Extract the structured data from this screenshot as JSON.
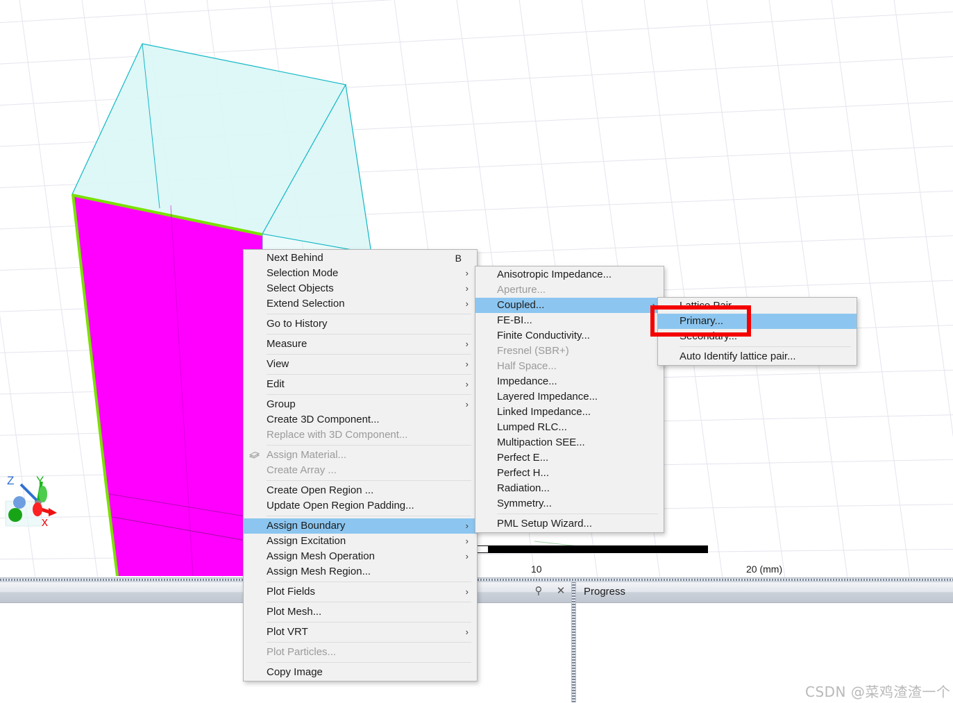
{
  "app": {
    "viewport_name": "3d-modeler-viewport",
    "background": "#ffffff",
    "grid_color": "#e3e3ec"
  },
  "geometry": {
    "top_face_color": "#ddf7f7",
    "top_face_edge_color": "#00b6c8",
    "selected_face_color": "#ff00ff",
    "selected_edge_color": "#7ae000",
    "description": "Rectangular box, top face shaded cyan, front-left face selected magenta"
  },
  "axis_triad": {
    "x_label": "x",
    "y_label": "Y",
    "z_label": "Z",
    "x_color": "#ee1111",
    "y_color": "#1bb81b",
    "z_color": "#2f6fd0"
  },
  "scale_bar": {
    "tick_mid": "10",
    "tick_end": "20 (mm)"
  },
  "bottom_panes": {
    "left_pane": {
      "title": "",
      "pin_icon": "pin-icon",
      "close_icon": "close-icon"
    },
    "right_pane": {
      "title": "Progress"
    }
  },
  "watermark": {
    "text": "CSDN @菜鸡渣渣一个"
  },
  "context_menu": {
    "name": "modeler-context-menu",
    "items": [
      {
        "label": "Next Behind",
        "accel": "B",
        "arrow": false,
        "disabled": false,
        "selected": false,
        "sep_after": false
      },
      {
        "label": "Selection Mode",
        "accel": "",
        "arrow": true,
        "disabled": false,
        "selected": false,
        "sep_after": false
      },
      {
        "label": "Select Objects",
        "accel": "",
        "arrow": true,
        "disabled": false,
        "selected": false,
        "sep_after": false
      },
      {
        "label": "Extend Selection",
        "accel": "",
        "arrow": true,
        "disabled": false,
        "selected": false,
        "sep_after": true
      },
      {
        "label": "Go to History",
        "accel": "",
        "arrow": false,
        "disabled": false,
        "selected": false,
        "sep_after": true
      },
      {
        "label": "Measure",
        "accel": "",
        "arrow": true,
        "disabled": false,
        "selected": false,
        "sep_after": true
      },
      {
        "label": "View",
        "accel": "",
        "arrow": true,
        "disabled": false,
        "selected": false,
        "sep_after": true
      },
      {
        "label": "Edit",
        "accel": "",
        "arrow": true,
        "disabled": false,
        "selected": false,
        "sep_after": true
      },
      {
        "label": "Group",
        "accel": "",
        "arrow": true,
        "disabled": false,
        "selected": false,
        "sep_after": false
      },
      {
        "label": "Create 3D Component...",
        "accel": "",
        "arrow": false,
        "disabled": false,
        "selected": false,
        "sep_after": false
      },
      {
        "label": "Replace with 3D Component...",
        "accel": "",
        "arrow": false,
        "disabled": true,
        "selected": false,
        "sep_after": true
      },
      {
        "label": "Assign Material...",
        "accel": "",
        "arrow": false,
        "disabled": true,
        "selected": false,
        "sep_after": false,
        "icon": "material-icon"
      },
      {
        "label": "Create Array ...",
        "accel": "",
        "arrow": false,
        "disabled": true,
        "selected": false,
        "sep_after": true
      },
      {
        "label": "Create Open Region ...",
        "accel": "",
        "arrow": false,
        "disabled": false,
        "selected": false,
        "sep_after": false
      },
      {
        "label": "Update Open Region Padding...",
        "accel": "",
        "arrow": false,
        "disabled": false,
        "selected": false,
        "sep_after": true
      },
      {
        "label": "Assign Boundary",
        "accel": "",
        "arrow": true,
        "disabled": false,
        "selected": true,
        "sep_after": false
      },
      {
        "label": "Assign Excitation",
        "accel": "",
        "arrow": true,
        "disabled": false,
        "selected": false,
        "sep_after": false
      },
      {
        "label": "Assign Mesh Operation",
        "accel": "",
        "arrow": true,
        "disabled": false,
        "selected": false,
        "sep_after": false
      },
      {
        "label": "Assign Mesh Region...",
        "accel": "",
        "arrow": false,
        "disabled": false,
        "selected": false,
        "sep_after": true
      },
      {
        "label": "Plot Fields",
        "accel": "",
        "arrow": true,
        "disabled": false,
        "selected": false,
        "sep_after": true
      },
      {
        "label": "Plot Mesh...",
        "accel": "",
        "arrow": false,
        "disabled": false,
        "selected": false,
        "sep_after": true
      },
      {
        "label": "Plot VRT",
        "accel": "",
        "arrow": true,
        "disabled": false,
        "selected": false,
        "sep_after": true
      },
      {
        "label": "Plot Particles...",
        "accel": "",
        "arrow": false,
        "disabled": true,
        "selected": false,
        "sep_after": true
      },
      {
        "label": "Copy Image",
        "accel": "",
        "arrow": false,
        "disabled": false,
        "selected": false,
        "sep_after": false
      }
    ]
  },
  "boundary_submenu": {
    "name": "assign-boundary-submenu",
    "items": [
      {
        "label": "Anisotropic Impedance...",
        "arrow": false,
        "disabled": false,
        "selected": false,
        "sep_after": false
      },
      {
        "label": "Aperture...",
        "arrow": false,
        "disabled": true,
        "selected": false,
        "sep_after": false
      },
      {
        "label": "Coupled...",
        "arrow": true,
        "disabled": false,
        "selected": true,
        "sep_after": false
      },
      {
        "label": "FE-BI...",
        "arrow": false,
        "disabled": false,
        "selected": false,
        "sep_after": false
      },
      {
        "label": "Finite Conductivity...",
        "arrow": false,
        "disabled": false,
        "selected": false,
        "sep_after": false
      },
      {
        "label": "Fresnel (SBR+)",
        "arrow": false,
        "disabled": true,
        "selected": false,
        "sep_after": false
      },
      {
        "label": "Half Space...",
        "arrow": false,
        "disabled": true,
        "selected": false,
        "sep_after": false
      },
      {
        "label": "Impedance...",
        "arrow": false,
        "disabled": false,
        "selected": false,
        "sep_after": false
      },
      {
        "label": "Layered Impedance...",
        "arrow": false,
        "disabled": false,
        "selected": false,
        "sep_after": false
      },
      {
        "label": "Linked Impedance...",
        "arrow": false,
        "disabled": false,
        "selected": false,
        "sep_after": false
      },
      {
        "label": "Lumped RLC...",
        "arrow": false,
        "disabled": false,
        "selected": false,
        "sep_after": false
      },
      {
        "label": "Multipaction SEE...",
        "arrow": false,
        "disabled": false,
        "selected": false,
        "sep_after": false
      },
      {
        "label": "Perfect E...",
        "arrow": false,
        "disabled": false,
        "selected": false,
        "sep_after": false
      },
      {
        "label": "Perfect H...",
        "arrow": false,
        "disabled": false,
        "selected": false,
        "sep_after": false
      },
      {
        "label": "Radiation...",
        "arrow": false,
        "disabled": false,
        "selected": false,
        "sep_after": false
      },
      {
        "label": "Symmetry...",
        "arrow": false,
        "disabled": false,
        "selected": false,
        "sep_after": true
      },
      {
        "label": "PML Setup Wizard...",
        "arrow": false,
        "disabled": false,
        "selected": false,
        "sep_after": false
      }
    ]
  },
  "coupled_submenu": {
    "name": "coupled-submenu",
    "items": [
      {
        "label": "Lattice Pair...",
        "arrow": false,
        "disabled": false,
        "selected": false,
        "sep_after": false
      },
      {
        "label": "Primary...",
        "arrow": false,
        "disabled": false,
        "selected": true,
        "sep_after": false
      },
      {
        "label": "Secondary...",
        "arrow": false,
        "disabled": false,
        "selected": false,
        "sep_after": true
      },
      {
        "label": "Auto Identify lattice pair...",
        "arrow": false,
        "disabled": false,
        "selected": false,
        "sep_after": false
      }
    ]
  },
  "annotation": {
    "highlight_box_color": "#f50000",
    "highlights_item": "Primary..."
  },
  "colors": {
    "menu_background": "#f1f1f1",
    "menu_border": "#b4b4b4",
    "selection_blue": "#8cc6f0",
    "disabled_text": "#9a9a9a",
    "text": "#1b1b1b"
  }
}
